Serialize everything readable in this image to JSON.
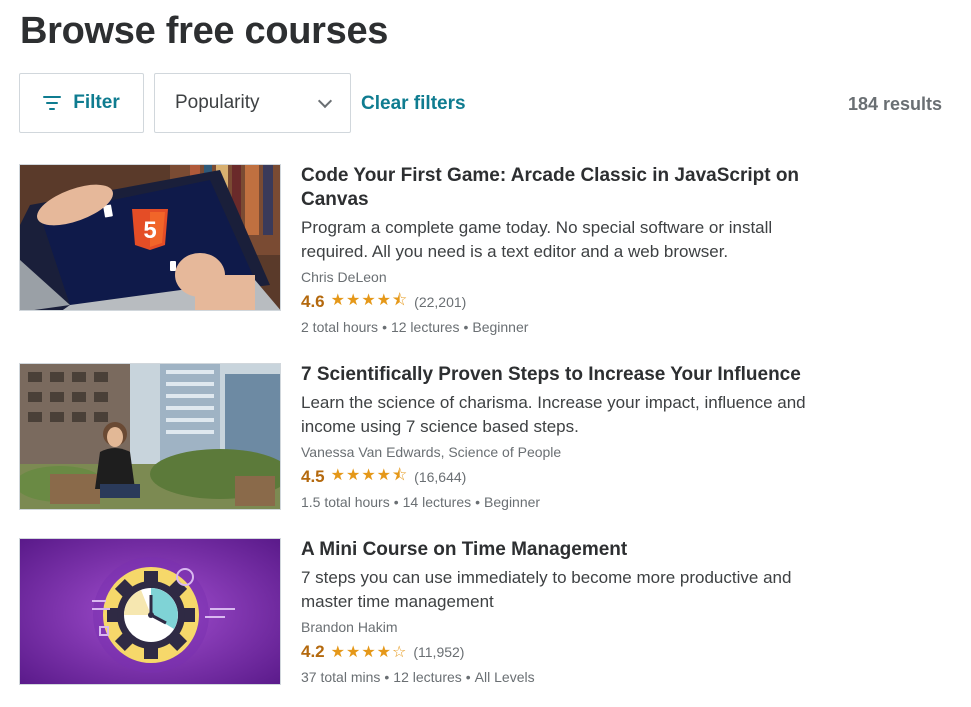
{
  "page": {
    "title": "Browse free courses"
  },
  "toolbar": {
    "filter_label": "Filter",
    "sort_value": "Popularity",
    "clear_label": "Clear filters",
    "results": "184 results"
  },
  "courses": [
    {
      "title": "Code Your First Game: Arcade Classic in JavaScript on Canvas",
      "description": "Program a complete game today. No special software or install required. All you need is a text editor and a web browser.",
      "author": "Chris DeLeon",
      "rating": "4.6",
      "stars": "★★★★⯪",
      "reviews": "(22,201)",
      "hours": "2 total hours",
      "lectures": "12 lectures",
      "level": "Beginner",
      "thumb_icon": "html5-laptop-icon"
    },
    {
      "title": "7 Scientifically Proven Steps to Increase Your Influence",
      "description": "Learn the science of charisma. Increase your impact, influence and income using 7 science based steps.",
      "author": "Vanessa Van Edwards, Science of People",
      "rating": "4.5",
      "stars": "★★★★⯪",
      "reviews": "(16,644)",
      "hours": "1.5 total hours",
      "lectures": "14 lectures",
      "level": "Beginner",
      "thumb_icon": "rooftop-portrait-image"
    },
    {
      "title": "A Mini Course on Time Management",
      "description": "7 steps you can use immediately to become more productive and master time management",
      "author": "Brandon Hakim",
      "rating": "4.2",
      "stars": "★★★★☆",
      "reviews": "(11,952)",
      "hours": "37 total mins",
      "lectures": "12 lectures",
      "level": "All Levels",
      "thumb_icon": "clock-gear-icon"
    }
  ],
  "colors": {
    "accent": "#0f7c90",
    "rating": "#b4690e",
    "stars": "#e59819",
    "muted": "#6a6f73"
  },
  "separator": "•"
}
